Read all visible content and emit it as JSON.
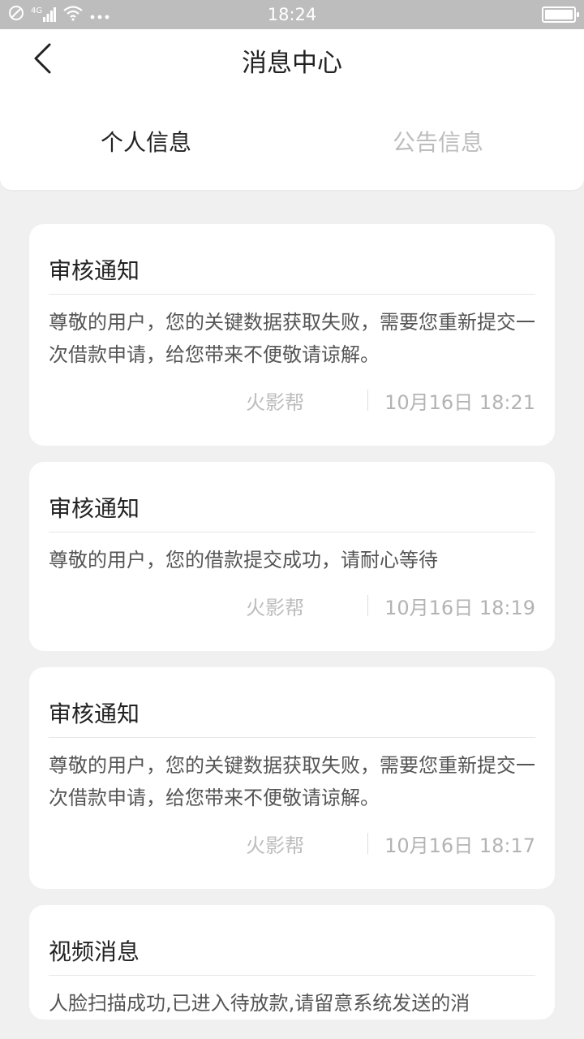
{
  "status_bar": {
    "time": "18:24",
    "network": "4G",
    "icons": [
      "dnd-icon",
      "signal-icon",
      "wifi-icon",
      "more-icon",
      "battery-icon"
    ]
  },
  "header": {
    "title": "消息中心"
  },
  "tabs": [
    {
      "label": "个人信息",
      "active": true
    },
    {
      "label": "公告信息",
      "active": false
    }
  ],
  "messages": [
    {
      "title": "审核通知",
      "body": "尊敬的用户，您的关键数据获取失败，需要您重新提交一次借款申请，给您带来不便敬请谅解。",
      "source": "火影帮",
      "time": "10月16日 18:21"
    },
    {
      "title": "审核通知",
      "body": "尊敬的用户，您的借款提交成功，请耐心等待",
      "source": "火影帮",
      "time": "10月16日 18:19"
    },
    {
      "title": "审核通知",
      "body": "尊敬的用户，您的关键数据获取失败，需要您重新提交一次借款申请，给您带来不便敬请谅解。",
      "source": "火影帮",
      "time": "10月16日 18:17"
    },
    {
      "title": "视频消息",
      "body": "人脸扫描成功,已进入待放款,请留意系统发送的消",
      "source": "",
      "time": ""
    }
  ],
  "colors": {
    "status_bar_bg": "#bdbdbd",
    "page_bg": "#f0f0f0",
    "active_tab": "#222222",
    "inactive_tab": "#bdbdbd",
    "meta_text": "#bdbdbd"
  }
}
